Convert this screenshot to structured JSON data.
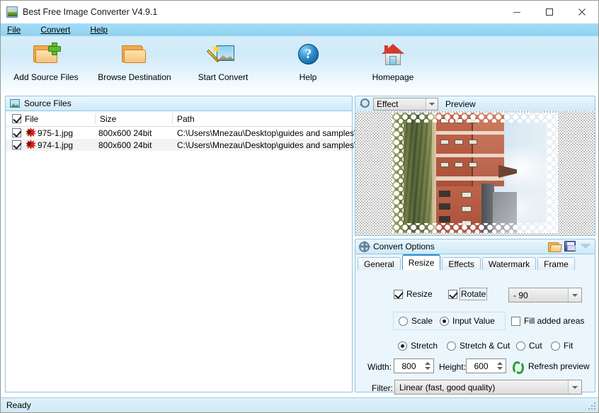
{
  "window": {
    "title": "Best Free Image Converter V4.9.1",
    "icon": "app-image-icon",
    "controls": {
      "minimize": "minimize-icon",
      "maximize": "maximize-icon",
      "close": "close-icon"
    }
  },
  "menubar": {
    "items": [
      "File",
      "Convert",
      "Help"
    ]
  },
  "toolbar": {
    "items": [
      {
        "label": "Add Source Files",
        "icon": "folder-add-icon"
      },
      {
        "label": "Browse Destination",
        "icon": "folder-icon"
      },
      {
        "label": "Start Convert",
        "icon": "wand-image-icon"
      },
      {
        "label": "Help",
        "icon": "question-circle-icon"
      },
      {
        "label": "Homepage",
        "icon": "home-icon"
      }
    ]
  },
  "source_files": {
    "panel_title": "Source Files",
    "panel_icon": "picture-icon",
    "header_checked": true,
    "columns": [
      "File",
      "Size",
      "Path"
    ],
    "rows": [
      {
        "checked": true,
        "icon": "image-file-icon",
        "file": "975-1.jpg",
        "size": "800x600  24bit",
        "path": "C:\\Users\\Mnezau\\Desktop\\guides and samples\\"
      },
      {
        "checked": true,
        "icon": "image-file-icon",
        "file": "974-1.jpg",
        "size": "800x600  24bit",
        "path": "C:\\Users\\Mnezau\\Desktop\\guides and samples\\"
      }
    ]
  },
  "preview": {
    "icon": "magnifier-icon",
    "effect_select": {
      "value": "Effect",
      "options": [
        "Effect"
      ]
    },
    "label": "Preview",
    "image_description": "rotated photo of brick building with lace frame"
  },
  "convert_options": {
    "title": "Convert Options",
    "title_icon": "gear-icon",
    "actions": [
      {
        "name": "open-profile-icon",
        "label": ""
      },
      {
        "name": "save-profile-icon",
        "label": ""
      },
      {
        "name": "collapse-chevron-icon",
        "label": ""
      }
    ],
    "tabs": [
      {
        "label": "General",
        "active": false
      },
      {
        "label": "Resize",
        "active": true
      },
      {
        "label": "Effects",
        "active": false
      },
      {
        "label": "Watermark",
        "active": false
      },
      {
        "label": "Frame",
        "active": false
      }
    ],
    "resize": {
      "resize_checkbox": {
        "label": "Resize",
        "checked": true
      },
      "rotate_checkbox": {
        "label": "Rotate",
        "checked": true
      },
      "rotate_select": {
        "value": "- 90",
        "options": [
          "- 90"
        ]
      },
      "mode_radios": [
        {
          "label": "Scale",
          "selected": false
        },
        {
          "label": "Input Value",
          "selected": true
        }
      ],
      "fill_checkbox": {
        "label": "Fill added areas",
        "checked": false
      },
      "fit_radios": [
        {
          "label": "Stretch",
          "selected": true
        },
        {
          "label": "Stretch & Cut",
          "selected": false
        },
        {
          "label": "Cut",
          "selected": false
        },
        {
          "label": "Fit",
          "selected": false
        }
      ],
      "width": {
        "label": "Width:",
        "value": "800"
      },
      "height": {
        "label": "Height:",
        "value": "600"
      },
      "refresh": {
        "label": "Refresh preview",
        "icon": "refresh-icon"
      },
      "filter": {
        "label": "Filter:",
        "value": "Linear (fast, good quality)",
        "options": [
          "Linear (fast, good quality)"
        ]
      }
    }
  },
  "statusbar": {
    "text": "Ready"
  },
  "colors": {
    "titlebar_blue": "#8fd2f2",
    "panel_border": "#8fc4e3",
    "accent": "#2f8fc9"
  }
}
